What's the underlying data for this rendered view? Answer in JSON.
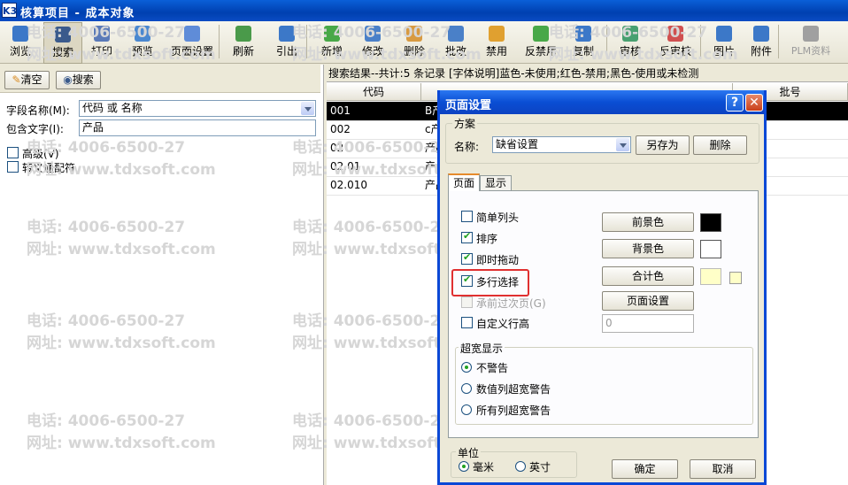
{
  "window": {
    "title": "核算项目 - 成本对象",
    "icon_label": "K3"
  },
  "toolbar": {
    "items": [
      {
        "label": "浏览",
        "icon": "browse-icon",
        "color": "#3c78c8"
      },
      {
        "label": "搜索",
        "icon": "binoculars-icon",
        "color": "#3a5a8c"
      },
      {
        "label": "打印",
        "icon": "printer-icon",
        "color": "#5a7ab8"
      },
      {
        "label": "预览",
        "icon": "preview-icon",
        "color": "#4a88d0"
      },
      {
        "label": "页面设置",
        "icon": "page-setup-icon",
        "color": "#5f8cd8"
      },
      {
        "label": "刷新",
        "icon": "refresh-icon",
        "color": "#4a9a4a"
      },
      {
        "label": "引出",
        "icon": "export-icon",
        "color": "#3c78c8"
      },
      {
        "label": "新增",
        "icon": "add-icon",
        "color": "#48a848"
      },
      {
        "label": "修改",
        "icon": "edit-icon",
        "color": "#4a80c8"
      },
      {
        "label": "删除",
        "icon": "delete-icon",
        "color": "#d89a40"
      },
      {
        "label": "批改",
        "icon": "batch-edit-icon",
        "color": "#4a80c8"
      },
      {
        "label": "禁用",
        "icon": "disable-icon",
        "color": "#e0a030"
      },
      {
        "label": "反禁用",
        "icon": "enable-icon",
        "color": "#48a848"
      },
      {
        "label": "复制",
        "icon": "copy-icon",
        "color": "#3c78c8"
      },
      {
        "label": "审核",
        "icon": "audit-icon",
        "color": "#48a070"
      },
      {
        "label": "反审核",
        "icon": "unaudit-icon",
        "color": "#d05050"
      },
      {
        "label": "图片",
        "icon": "picture-icon",
        "color": "#3c78c8"
      },
      {
        "label": "附件",
        "icon": "attachment-icon",
        "color": "#3c78c8"
      },
      {
        "label": "PLM资料",
        "icon": "plm-icon",
        "color": "#a0a0a0"
      }
    ]
  },
  "search_panel": {
    "clear_label": "清空",
    "search_label": "搜索",
    "field_name_label": "字段名称(M):",
    "field_name_value": "代码 或 名称",
    "contains_label": "包含文字(I):",
    "contains_value": "产品",
    "advanced_label": "高级(V)",
    "wildcard_label": "转义通配符"
  },
  "grid": {
    "status": "搜索结果--共计:5 条记录 [字体说明]蓝色-未使用;红色-禁用;黑色-使用或未检测",
    "columns": [
      "代码",
      "",
      "批号"
    ],
    "rows": [
      {
        "code": "001",
        "name": "B产"
      },
      {
        "code": "002",
        "name": "c产"
      },
      {
        "code": "02",
        "name": "产品"
      },
      {
        "code": "02.01",
        "name": "产品"
      },
      {
        "code": "02.010",
        "name": "产品"
      }
    ]
  },
  "watermark": {
    "phone": "电话: 4006-6500-27",
    "site": "网址: www.tdxsoft.com"
  },
  "dialog": {
    "title": "页面设置",
    "help_glyph": "?",
    "close_glyph": "✕",
    "scheme_group": "方案",
    "name_label": "名称:",
    "scheme_value": "缺省设置",
    "save_as_label": "另存为",
    "delete_label": "删除",
    "tabs": [
      "页面",
      "显示"
    ],
    "options": {
      "simple_header": "简单列头",
      "sort": "排序",
      "drag": "即时拖动",
      "multi_select": "多行选择",
      "carry_over": "承前过次页(G)",
      "custom_row_height": "自定义行高"
    },
    "row_height_value": "0",
    "color_buttons": {
      "foreground": "前景色",
      "background": "背景色",
      "total": "合计色",
      "page_setup": "页面设置"
    },
    "swatch_colors": {
      "foreground": "#000000",
      "background": "#ffffff",
      "total": "#ffffc8",
      "total_small": "#ffffc8"
    },
    "overwidth": {
      "title": "超宽显示",
      "no_warn": "不警告",
      "numeric_warn": "数值列超宽警告",
      "all_warn": "所有列超宽警告"
    },
    "unit": {
      "title": "单位",
      "mm": "毫米",
      "inch": "英寸"
    },
    "ok_label": "确定",
    "cancel_label": "取消"
  }
}
